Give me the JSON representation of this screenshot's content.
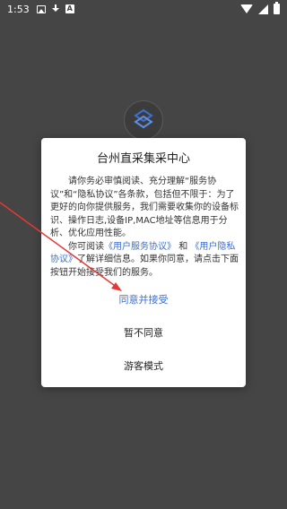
{
  "status_bar": {
    "time": "1:53",
    "icons_left": [
      "image-icon",
      "download-icon",
      "a-badge-icon"
    ],
    "icons_right": [
      "wifi-icon",
      "signal-icon",
      "battery-icon"
    ]
  },
  "dialog": {
    "title": "台州直采集采中心",
    "para1": "请你务必审慎阅读、充分理解“服务协议”和“隐私协议”各条款，包括但不限于：为了更好的向你提供服务，我们需要收集你的设备标识、操作日志,设备IP,MAC地址等信息用于分析、优化应用性能。",
    "para2_prefix": "你可阅读",
    "link_service": "《用户服务协议》",
    "para2_and": "和",
    "link_privacy": "《用户隐私协议》",
    "para2_suffix": "了解详细信息。如果你同意，请点击下面按钮开始接受我们的服务。",
    "accept_label": "同意并接受",
    "decline_label": "暂不同意",
    "guest_label": "游客模式"
  },
  "colors": {
    "link": "#3b6fd0",
    "annotation_arrow": "#e53935",
    "backdrop": "#454545"
  }
}
